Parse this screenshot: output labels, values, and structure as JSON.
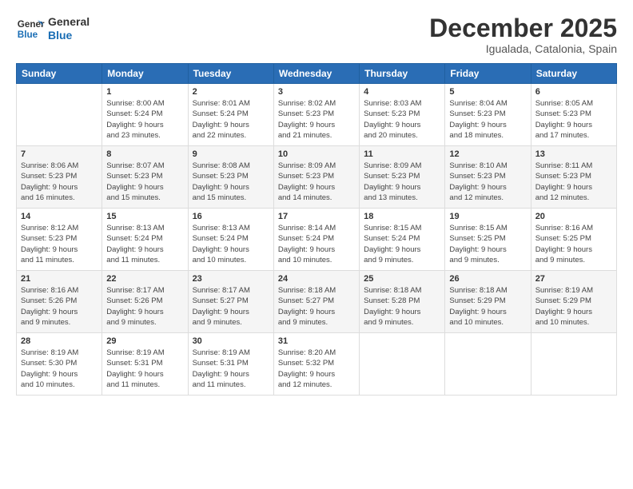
{
  "logo": {
    "line1": "General",
    "line2": "Blue"
  },
  "title": "December 2025",
  "location": "Igualada, Catalonia, Spain",
  "days_of_week": [
    "Sunday",
    "Monday",
    "Tuesday",
    "Wednesday",
    "Thursday",
    "Friday",
    "Saturday"
  ],
  "weeks": [
    [
      {
        "num": "",
        "info": ""
      },
      {
        "num": "1",
        "info": "Sunrise: 8:00 AM\nSunset: 5:24 PM\nDaylight: 9 hours\nand 23 minutes."
      },
      {
        "num": "2",
        "info": "Sunrise: 8:01 AM\nSunset: 5:24 PM\nDaylight: 9 hours\nand 22 minutes."
      },
      {
        "num": "3",
        "info": "Sunrise: 8:02 AM\nSunset: 5:23 PM\nDaylight: 9 hours\nand 21 minutes."
      },
      {
        "num": "4",
        "info": "Sunrise: 8:03 AM\nSunset: 5:23 PM\nDaylight: 9 hours\nand 20 minutes."
      },
      {
        "num": "5",
        "info": "Sunrise: 8:04 AM\nSunset: 5:23 PM\nDaylight: 9 hours\nand 18 minutes."
      },
      {
        "num": "6",
        "info": "Sunrise: 8:05 AM\nSunset: 5:23 PM\nDaylight: 9 hours\nand 17 minutes."
      }
    ],
    [
      {
        "num": "7",
        "info": "Sunrise: 8:06 AM\nSunset: 5:23 PM\nDaylight: 9 hours\nand 16 minutes."
      },
      {
        "num": "8",
        "info": "Sunrise: 8:07 AM\nSunset: 5:23 PM\nDaylight: 9 hours\nand 15 minutes."
      },
      {
        "num": "9",
        "info": "Sunrise: 8:08 AM\nSunset: 5:23 PM\nDaylight: 9 hours\nand 15 minutes."
      },
      {
        "num": "10",
        "info": "Sunrise: 8:09 AM\nSunset: 5:23 PM\nDaylight: 9 hours\nand 14 minutes."
      },
      {
        "num": "11",
        "info": "Sunrise: 8:09 AM\nSunset: 5:23 PM\nDaylight: 9 hours\nand 13 minutes."
      },
      {
        "num": "12",
        "info": "Sunrise: 8:10 AM\nSunset: 5:23 PM\nDaylight: 9 hours\nand 12 minutes."
      },
      {
        "num": "13",
        "info": "Sunrise: 8:11 AM\nSunset: 5:23 PM\nDaylight: 9 hours\nand 12 minutes."
      }
    ],
    [
      {
        "num": "14",
        "info": "Sunrise: 8:12 AM\nSunset: 5:23 PM\nDaylight: 9 hours\nand 11 minutes."
      },
      {
        "num": "15",
        "info": "Sunrise: 8:13 AM\nSunset: 5:24 PM\nDaylight: 9 hours\nand 11 minutes."
      },
      {
        "num": "16",
        "info": "Sunrise: 8:13 AM\nSunset: 5:24 PM\nDaylight: 9 hours\nand 10 minutes."
      },
      {
        "num": "17",
        "info": "Sunrise: 8:14 AM\nSunset: 5:24 PM\nDaylight: 9 hours\nand 10 minutes."
      },
      {
        "num": "18",
        "info": "Sunrise: 8:15 AM\nSunset: 5:24 PM\nDaylight: 9 hours\nand 9 minutes."
      },
      {
        "num": "19",
        "info": "Sunrise: 8:15 AM\nSunset: 5:25 PM\nDaylight: 9 hours\nand 9 minutes."
      },
      {
        "num": "20",
        "info": "Sunrise: 8:16 AM\nSunset: 5:25 PM\nDaylight: 9 hours\nand 9 minutes."
      }
    ],
    [
      {
        "num": "21",
        "info": "Sunrise: 8:16 AM\nSunset: 5:26 PM\nDaylight: 9 hours\nand 9 minutes."
      },
      {
        "num": "22",
        "info": "Sunrise: 8:17 AM\nSunset: 5:26 PM\nDaylight: 9 hours\nand 9 minutes."
      },
      {
        "num": "23",
        "info": "Sunrise: 8:17 AM\nSunset: 5:27 PM\nDaylight: 9 hours\nand 9 minutes."
      },
      {
        "num": "24",
        "info": "Sunrise: 8:18 AM\nSunset: 5:27 PM\nDaylight: 9 hours\nand 9 minutes."
      },
      {
        "num": "25",
        "info": "Sunrise: 8:18 AM\nSunset: 5:28 PM\nDaylight: 9 hours\nand 9 minutes."
      },
      {
        "num": "26",
        "info": "Sunrise: 8:18 AM\nSunset: 5:29 PM\nDaylight: 9 hours\nand 10 minutes."
      },
      {
        "num": "27",
        "info": "Sunrise: 8:19 AM\nSunset: 5:29 PM\nDaylight: 9 hours\nand 10 minutes."
      }
    ],
    [
      {
        "num": "28",
        "info": "Sunrise: 8:19 AM\nSunset: 5:30 PM\nDaylight: 9 hours\nand 10 minutes."
      },
      {
        "num": "29",
        "info": "Sunrise: 8:19 AM\nSunset: 5:31 PM\nDaylight: 9 hours\nand 11 minutes."
      },
      {
        "num": "30",
        "info": "Sunrise: 8:19 AM\nSunset: 5:31 PM\nDaylight: 9 hours\nand 11 minutes."
      },
      {
        "num": "31",
        "info": "Sunrise: 8:20 AM\nSunset: 5:32 PM\nDaylight: 9 hours\nand 12 minutes."
      },
      {
        "num": "",
        "info": ""
      },
      {
        "num": "",
        "info": ""
      },
      {
        "num": "",
        "info": ""
      }
    ]
  ]
}
